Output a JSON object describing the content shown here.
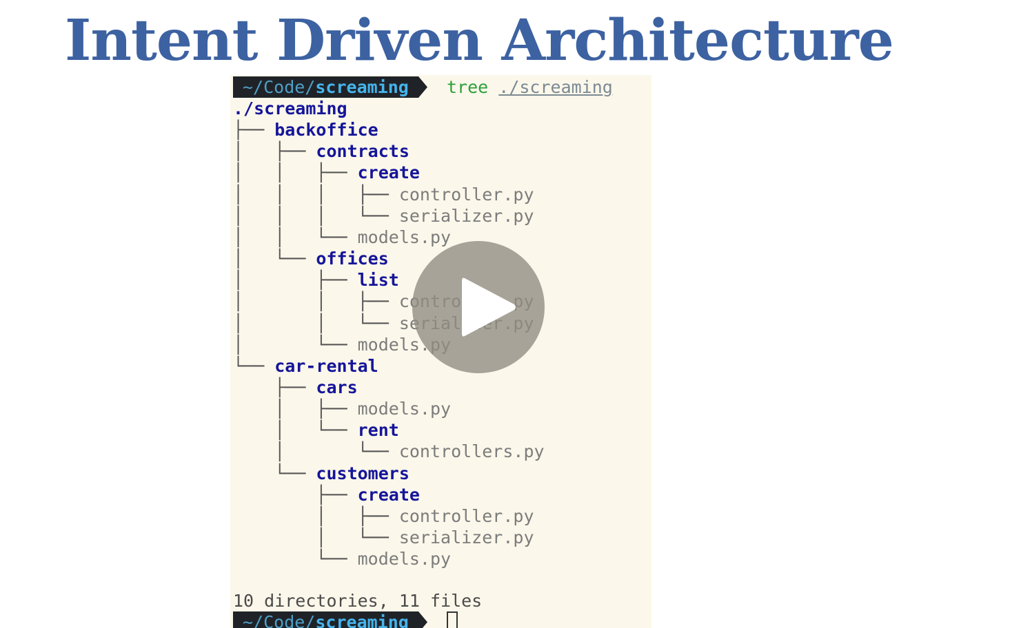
{
  "slide": {
    "title": "Intent Driven Architecture"
  },
  "terminal": {
    "prompt": {
      "path_prefix": "~/Code/",
      "path_current": "screaming"
    },
    "command": {
      "name": "tree",
      "argument": "./screaming"
    },
    "tree": [
      {
        "prefix": "",
        "name": "./screaming",
        "kind": "dir"
      },
      {
        "prefix": "├── ",
        "name": "backoffice",
        "kind": "dir"
      },
      {
        "prefix": "│   ├── ",
        "name": "contracts",
        "kind": "dir"
      },
      {
        "prefix": "│   │   ├── ",
        "name": "create",
        "kind": "dir"
      },
      {
        "prefix": "│   │   │   ├── ",
        "name": "controller.py",
        "kind": "file"
      },
      {
        "prefix": "│   │   │   └── ",
        "name": "serializer.py",
        "kind": "file"
      },
      {
        "prefix": "│   │   └── ",
        "name": "models.py",
        "kind": "file"
      },
      {
        "prefix": "│   └── ",
        "name": "offices",
        "kind": "dir"
      },
      {
        "prefix": "│       ├── ",
        "name": "list",
        "kind": "dir"
      },
      {
        "prefix": "│       │   ├── ",
        "name": "controller.py",
        "kind": "file"
      },
      {
        "prefix": "│       │   └── ",
        "name": "serializer.py",
        "kind": "file"
      },
      {
        "prefix": "│       └── ",
        "name": "models.py",
        "kind": "file"
      },
      {
        "prefix": "└── ",
        "name": "car-rental",
        "kind": "dir"
      },
      {
        "prefix": "    ├── ",
        "name": "cars",
        "kind": "dir"
      },
      {
        "prefix": "    │   ├── ",
        "name": "models.py",
        "kind": "file"
      },
      {
        "prefix": "    │   └── ",
        "name": "rent",
        "kind": "dir"
      },
      {
        "prefix": "    │       └── ",
        "name": "controllers.py",
        "kind": "file"
      },
      {
        "prefix": "    └── ",
        "name": "customers",
        "kind": "dir"
      },
      {
        "prefix": "        ├── ",
        "name": "create",
        "kind": "dir"
      },
      {
        "prefix": "        │   ├── ",
        "name": "controller.py",
        "kind": "file"
      },
      {
        "prefix": "        │   └── ",
        "name": "serializer.py",
        "kind": "file"
      },
      {
        "prefix": "        └── ",
        "name": "models.py",
        "kind": "file"
      }
    ],
    "summary": "10 directories, 11 files"
  },
  "player": {
    "icon": "play-icon",
    "overlay_color": "#918c82"
  },
  "colors": {
    "title": "#3d62a2",
    "terminal_bg": "#fbf7ea",
    "directory": "#15159a",
    "file": "#7c7c7c",
    "command": "#2e9e3a",
    "prompt_bg": "#1f2328",
    "prompt_path": "#46b4ec"
  }
}
